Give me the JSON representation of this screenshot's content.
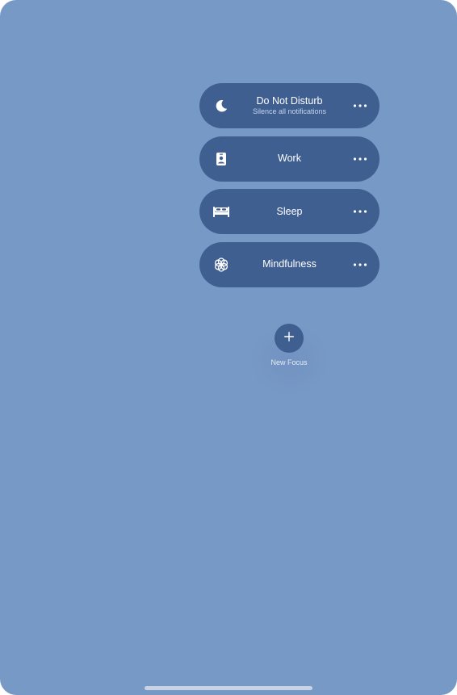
{
  "focus_modes": [
    {
      "title": "Do Not Disturb",
      "subtitle": "Silence all notifications",
      "icon": "moon-icon"
    },
    {
      "title": "Work",
      "subtitle": "",
      "icon": "id-badge-icon"
    },
    {
      "title": "Sleep",
      "subtitle": "",
      "icon": "bed-icon"
    },
    {
      "title": "Mindfulness",
      "subtitle": "",
      "icon": "flower-icon"
    }
  ],
  "new_focus": {
    "label": "New Focus",
    "icon": "plus-icon"
  },
  "colors": {
    "background": "#7799c5",
    "pill": "#3f5f91",
    "text": "#ffffff"
  }
}
